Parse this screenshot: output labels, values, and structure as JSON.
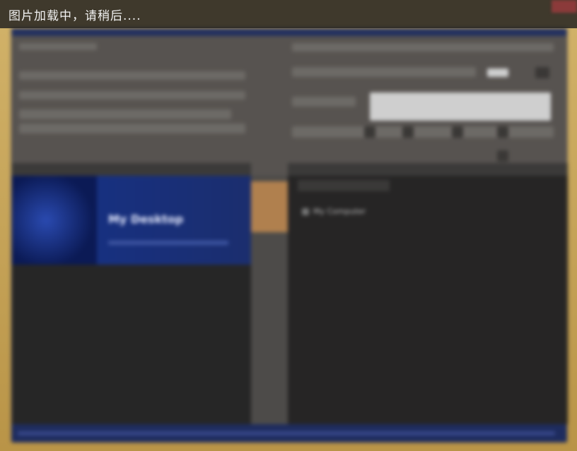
{
  "loading": {
    "text": "图片加载中，请稍后...."
  },
  "left_pane": {
    "banner_title": "My Desktop"
  },
  "right_pane": {
    "tree_item_label": "My Computer"
  }
}
